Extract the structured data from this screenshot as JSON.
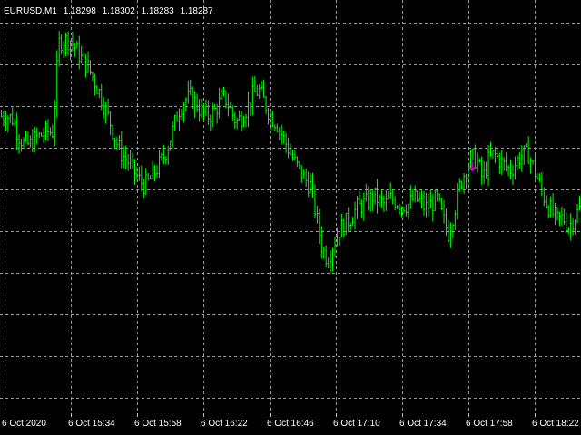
{
  "window": {
    "symbol_timeframe": "EURUSD,M1",
    "open": "1.18298",
    "high": "1.18302",
    "low": "1.18283",
    "close": "1.18287"
  },
  "colors": {
    "background": "#000000",
    "grid": "#9a9a9a",
    "candle": "#00ff00",
    "marker": "#ff00ff",
    "text": "#ffffff"
  },
  "time_axis": {
    "labels": [
      "6 Oct 2020",
      "6 Oct 15:34",
      "6 Oct 15:58",
      "6 Oct 16:22",
      "6 Oct 16:46",
      "6 Oct 17:10",
      "6 Oct 17:34",
      "6 Oct 17:58",
      "6 Oct 18:22"
    ]
  },
  "icons": {
    "sell_arrow": "arrow-down-icon"
  },
  "chart_data": {
    "type": "line",
    "title": "EURUSD,M1",
    "xlabel": "",
    "ylabel": "",
    "grid": true,
    "x_ticks": [
      "6 Oct 2020",
      "6 Oct 15:34",
      "6 Oct 15:58",
      "6 Oct 16:22",
      "6 Oct 16:46",
      "6 Oct 17:10",
      "6 Oct 17:34",
      "6 Oct 17:58",
      "6 Oct 18:22"
    ],
    "price_profile": [
      0.72,
      0.72,
      0.71,
      0.66,
      0.63,
      0.63,
      0.65,
      0.66,
      0.67,
      0.67,
      0.95,
      0.96,
      0.96,
      0.93,
      0.9,
      0.88,
      0.84,
      0.8,
      0.75,
      0.7,
      0.64,
      0.6,
      0.58,
      0.55,
      0.52,
      0.5,
      0.52,
      0.55,
      0.58,
      0.62,
      0.68,
      0.74,
      0.77,
      0.78,
      0.76,
      0.73,
      0.72,
      0.73,
      0.76,
      0.78,
      0.74,
      0.7,
      0.72,
      0.75,
      0.79,
      0.8,
      0.76,
      0.72,
      0.7,
      0.66,
      0.62,
      0.58,
      0.55,
      0.52,
      0.5,
      0.4,
      0.3,
      0.27,
      0.32,
      0.36,
      0.38,
      0.4,
      0.43,
      0.44,
      0.45,
      0.47,
      0.45,
      0.44,
      0.46,
      0.45,
      0.44,
      0.44,
      0.46,
      0.45,
      0.43,
      0.44,
      0.46,
      0.4,
      0.35,
      0.42,
      0.5,
      0.55,
      0.59,
      0.58,
      0.52,
      0.58,
      0.6,
      0.58,
      0.56,
      0.55,
      0.58,
      0.6,
      0.6,
      0.55,
      0.5,
      0.45,
      0.42,
      0.39,
      0.4,
      0.37,
      0.4,
      0.43
    ],
    "sell_signal_index": 81
  }
}
